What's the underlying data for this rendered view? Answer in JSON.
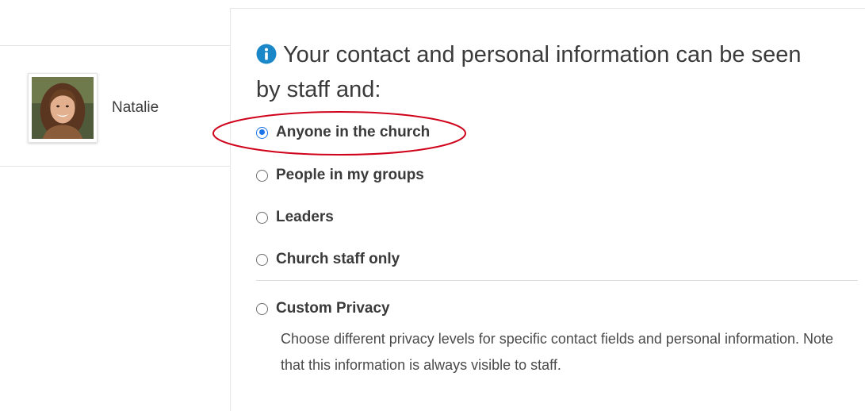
{
  "user": {
    "name": "Natalie",
    "avatar_alt": "Natalie profile photo"
  },
  "privacy": {
    "heading": "Your contact and personal information can be seen by staff and:",
    "options": [
      {
        "label": "Anyone in the church",
        "selected": true
      },
      {
        "label": "People in my groups",
        "selected": false
      },
      {
        "label": "Leaders",
        "selected": false
      },
      {
        "label": "Church staff only",
        "selected": false
      },
      {
        "label": "Custom Privacy",
        "selected": false
      }
    ],
    "custom_description": "Choose different privacy levels for specific contact fields and personal information. Note that this information is always visible to staff."
  },
  "colors": {
    "info_icon": "#1a87c9",
    "radio_selected": "#1a73e8",
    "annotation": "#d0021b"
  },
  "icons": {
    "info": "info-circle-icon"
  }
}
